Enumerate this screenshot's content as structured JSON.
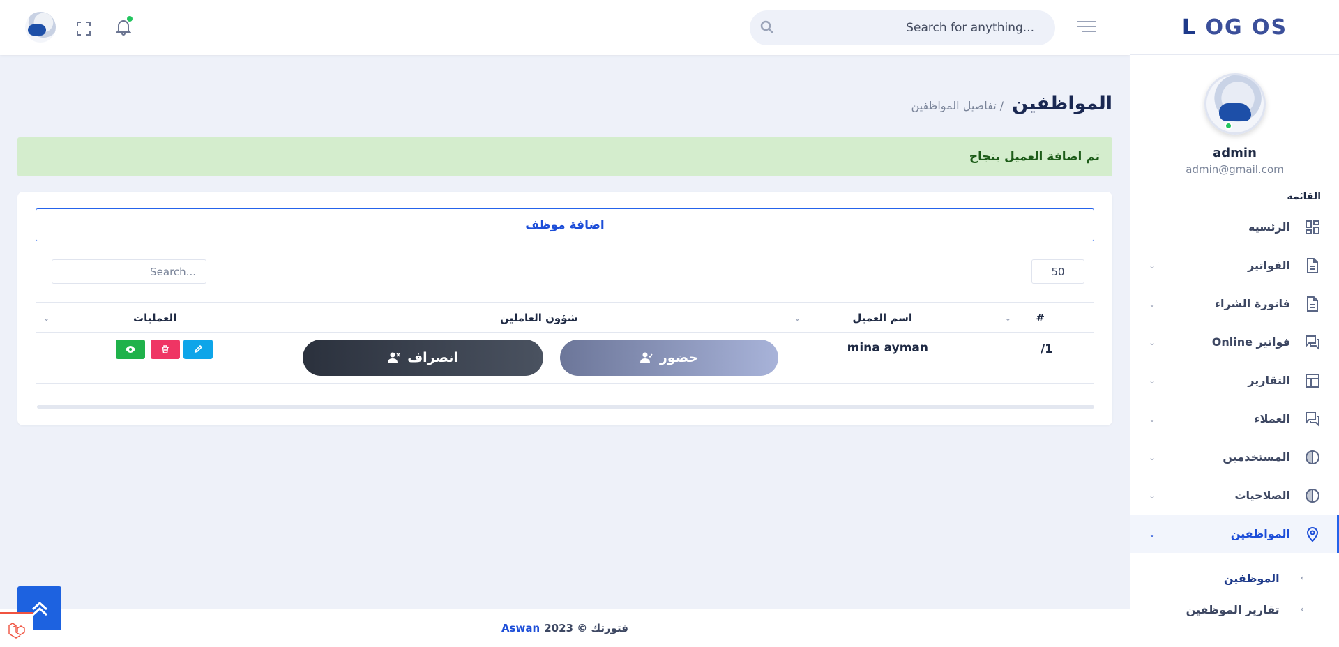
{
  "sidebar": {
    "logo": {
      "l": "L",
      "rest1": "OG",
      "rest2": "OS"
    },
    "user": {
      "name": "admin",
      "email": "admin@gmail.com"
    },
    "menu_title": "القائمه",
    "items": [
      {
        "label": "الرئسيه",
        "icon": "dashboard-icon"
      },
      {
        "label": "الفواتير",
        "icon": "document-icon"
      },
      {
        "label": "فاتورة الشراء",
        "icon": "document-icon"
      },
      {
        "label": "فواتير Online",
        "icon": "chat-icon"
      },
      {
        "label": "التقارير",
        "icon": "table-icon"
      },
      {
        "label": "العملاء",
        "icon": "chat-icon"
      },
      {
        "label": "المستخدمين",
        "icon": "half-circle-icon"
      },
      {
        "label": "الصلاحيات",
        "icon": "half-circle-icon"
      },
      {
        "label": "المواظفين",
        "icon": "location-pin-icon"
      }
    ],
    "sub_items": [
      {
        "label": "الموظفين"
      },
      {
        "label": "تقارير الموظفين"
      }
    ]
  },
  "header": {
    "search_placeholder": "...Search for anything"
  },
  "page": {
    "title": "المواظفين",
    "breadcrumb": "/ تفاصيل المواظفين"
  },
  "alert": {
    "text": "تم اضافة العميل بنجاح"
  },
  "card": {
    "add_button": "اضافة موظف",
    "per_page": "50",
    "search_placeholder": "Search..."
  },
  "table": {
    "headers": {
      "index": "#",
      "name": "اسم العميل",
      "affairs": "شؤون العاملين",
      "ops": "العمليات"
    },
    "rows": [
      {
        "index": "/1",
        "name": "mina ayman",
        "attend": "حضور",
        "leave": "انصراف"
      }
    ]
  },
  "footer": {
    "text": "فتورتك © 2023",
    "brand": "Aswan"
  },
  "colors": {
    "primary": "#1d4ed8",
    "success_bg": "#d4edcd",
    "danger": "#ef3564",
    "info": "#0ea5e9",
    "success": "#1fb24a"
  }
}
